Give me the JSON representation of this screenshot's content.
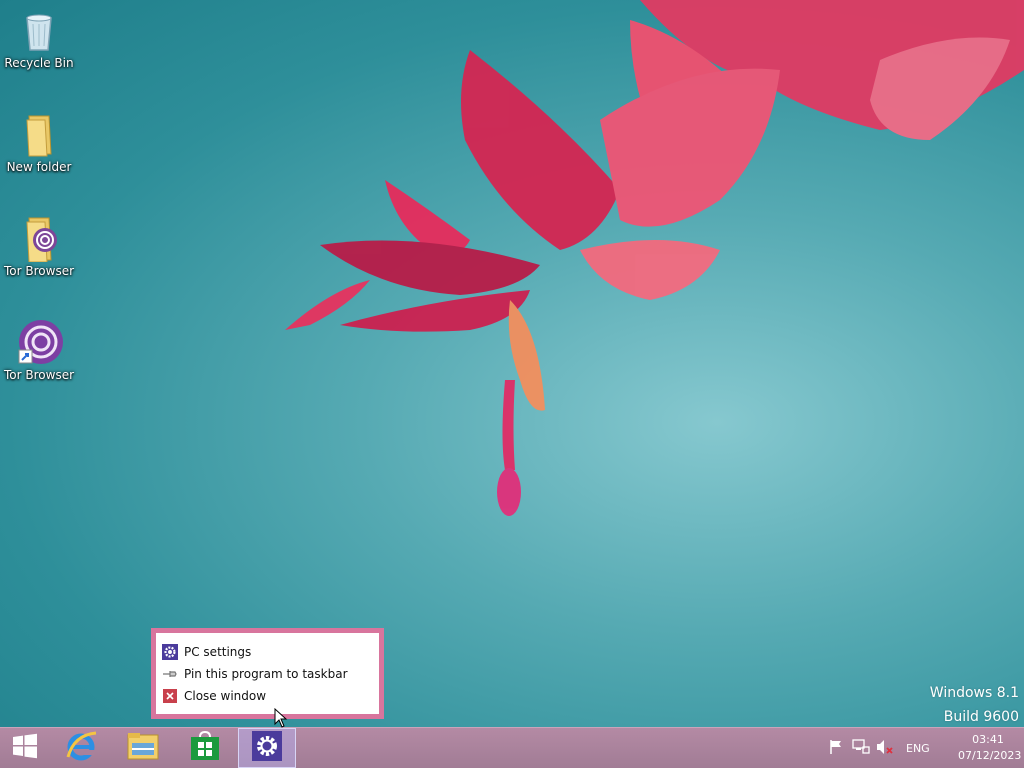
{
  "desktop": {
    "icons": [
      {
        "label": "Recycle Bin",
        "icon": "recycle-bin-icon"
      },
      {
        "label": "New folder",
        "icon": "folder-icon"
      },
      {
        "label": "Tor Browser",
        "icon": "tor-folder-icon"
      },
      {
        "label": "Tor Browser",
        "icon": "tor-browser-shortcut-icon"
      }
    ]
  },
  "context_menu": {
    "items": [
      {
        "label": "PC settings",
        "icon": "gear-icon"
      },
      {
        "label": "Pin this program to taskbar",
        "icon": "pin-icon"
      },
      {
        "label": "Close window",
        "icon": "close-icon"
      }
    ]
  },
  "watermark": {
    "line1": "Windows 8.1",
    "line2": "Build 9600"
  },
  "taskbar": {
    "buttons": [
      {
        "name": "start",
        "icon": "windows-logo-icon"
      },
      {
        "name": "internet-explorer",
        "icon": "internet-explorer-icon"
      },
      {
        "name": "file-explorer",
        "icon": "file-explorer-icon"
      },
      {
        "name": "store",
        "icon": "store-icon"
      },
      {
        "name": "pc-settings",
        "icon": "gear-icon",
        "active": true
      }
    ],
    "tray": {
      "language": "ENG",
      "time": "03:41",
      "date": "07/12/2023"
    }
  },
  "colors": {
    "context_menu_border": "#d8759d",
    "taskbar": "#a9819b",
    "settings_accent": "#4b3b9c"
  }
}
